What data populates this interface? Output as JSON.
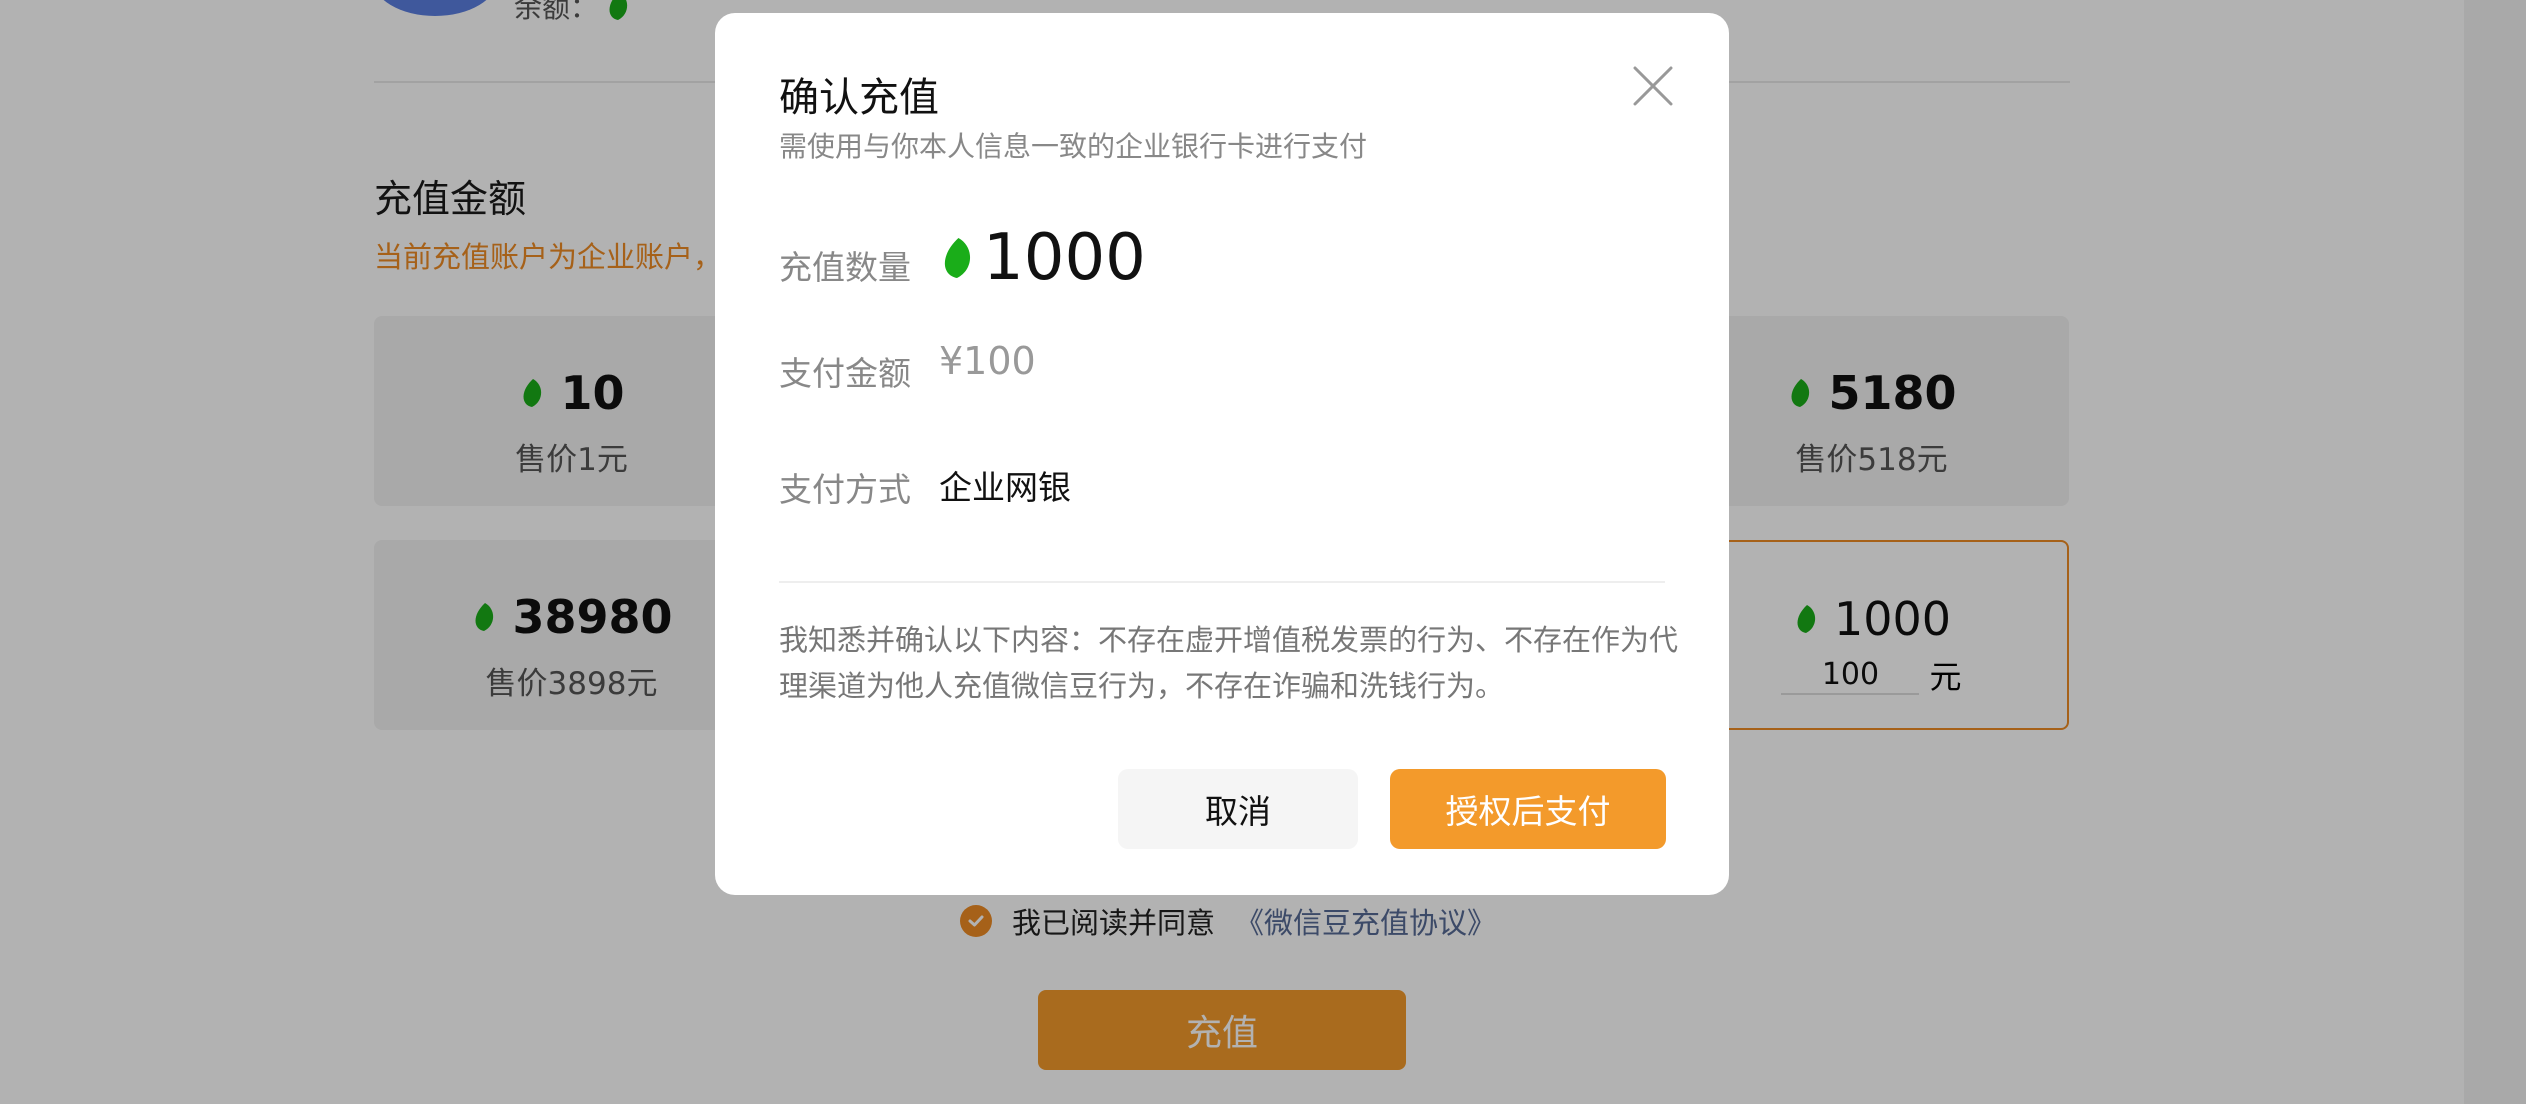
{
  "background": {
    "balance_label": "余额：",
    "section_title": "充值金额",
    "section_subtitle": "当前充值账户为企业账户，",
    "packages": [
      {
        "amount": "10",
        "price": "售价1元"
      },
      {
        "amount": "5180",
        "price": "售价518元"
      },
      {
        "amount": "38980",
        "price": "售价3898元"
      }
    ],
    "custom_package": {
      "amount": "1000",
      "input_value": "100",
      "unit": "元"
    },
    "agreement_text": "我已阅读并同意",
    "agreement_link": "《微信豆充值协议》",
    "recharge_button": "充值"
  },
  "modal": {
    "title": "确认充值",
    "subtitle": "需使用与你本人信息一致的企业银行卡进行支付",
    "quantity_label": "充值数量",
    "quantity_value": "1000",
    "amount_label": "支付金额",
    "amount_value": "¥100",
    "method_label": "支付方式",
    "method_value": "企业网银",
    "notice": "我知悉并确认以下内容：不存在虚开增值税发票的行为、不存在作为代理渠道为他人充值微信豆行为，不存在诈骗和洗钱行为。",
    "cancel_button": "取消",
    "pay_button": "授权后支付"
  },
  "colors": {
    "accent": "#f39a2b",
    "bean_green": "#1aad19",
    "link": "#576b95",
    "overlay": "rgba(0,0,0,0.30)"
  },
  "icons": [
    "wechat-bean-icon",
    "close-icon",
    "check-circle-icon"
  ]
}
